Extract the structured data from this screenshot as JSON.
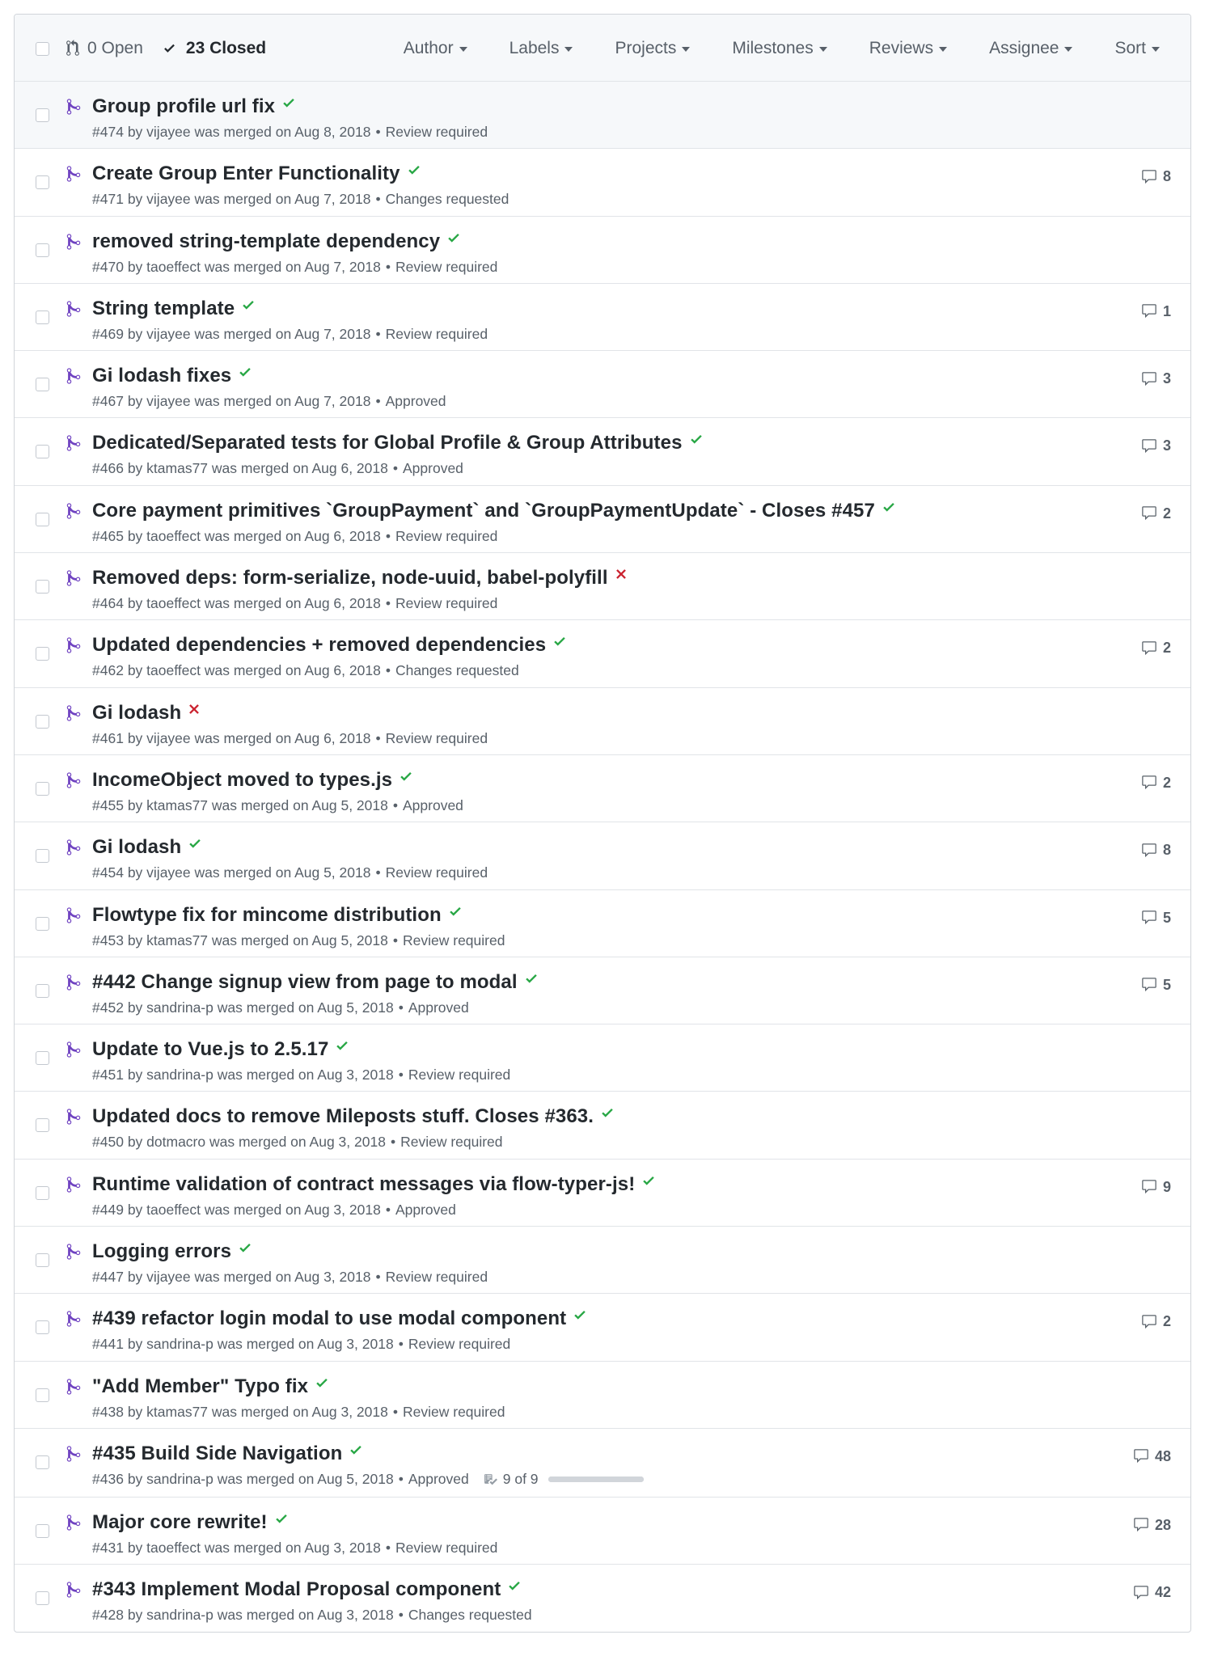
{
  "states": {
    "open": "0 Open",
    "closed": "23 Closed"
  },
  "filters": [
    "Author",
    "Labels",
    "Projects",
    "Milestones",
    "Reviews",
    "Assignee",
    "Sort"
  ],
  "colors": {
    "merged": "#6f42c1",
    "success": "#28a745",
    "failure": "#cb2431",
    "muted": "#586069"
  },
  "pull_requests": [
    {
      "title": "Group profile url fix",
      "status": "success",
      "meta": {
        "number": "#474",
        "by": "by",
        "author": "vijayee",
        "merged": "was merged on Aug 8, 2018",
        "review": "Review required"
      },
      "comments": ""
    },
    {
      "title": "Create Group Enter Functionality",
      "status": "success",
      "meta": {
        "number": "#471",
        "by": "by",
        "author": "vijayee",
        "merged": "was merged on Aug 7, 2018",
        "review": "Changes requested"
      },
      "comments": "8"
    },
    {
      "title": "removed string-template dependency",
      "status": "success",
      "meta": {
        "number": "#470",
        "by": "by",
        "author": "taoeffect",
        "merged": "was merged on Aug 7, 2018",
        "review": "Review required"
      },
      "comments": ""
    },
    {
      "title": "String template",
      "status": "success",
      "meta": {
        "number": "#469",
        "by": "by",
        "author": "vijayee",
        "merged": "was merged on Aug 7, 2018",
        "review": "Review required"
      },
      "comments": "1"
    },
    {
      "title": "Gi lodash fixes",
      "status": "success",
      "meta": {
        "number": "#467",
        "by": "by",
        "author": "vijayee",
        "merged": "was merged on Aug 7, 2018",
        "review": "Approved"
      },
      "comments": "3"
    },
    {
      "title": "Dedicated/Separated tests for Global Profile & Group Attributes",
      "status": "success",
      "meta": {
        "number": "#466",
        "by": "by",
        "author": "ktamas77",
        "merged": "was merged on Aug 6, 2018",
        "review": "Approved"
      },
      "comments": "3"
    },
    {
      "title": "Core payment primitives `GroupPayment` and `GroupPaymentUpdate` - Closes #457",
      "status": "success",
      "meta": {
        "number": "#465",
        "by": "by",
        "author": "taoeffect",
        "merged": "was merged on Aug 6, 2018",
        "review": "Review required"
      },
      "comments": "2"
    },
    {
      "title": "Removed deps: form-serialize, node-uuid, babel-polyfill",
      "status": "failure",
      "meta": {
        "number": "#464",
        "by": "by",
        "author": "taoeffect",
        "merged": "was merged on Aug 6, 2018",
        "review": "Review required"
      },
      "comments": ""
    },
    {
      "title": "Updated dependencies + removed dependencies",
      "status": "success",
      "meta": {
        "number": "#462",
        "by": "by",
        "author": "taoeffect",
        "merged": "was merged on Aug 6, 2018",
        "review": "Changes requested"
      },
      "comments": "2"
    },
    {
      "title": "Gi lodash",
      "status": "failure",
      "meta": {
        "number": "#461",
        "by": "by",
        "author": "vijayee",
        "merged": "was merged on Aug 6, 2018",
        "review": "Review required"
      },
      "comments": ""
    },
    {
      "title": "IncomeObject moved to types.js",
      "status": "success",
      "meta": {
        "number": "#455",
        "by": "by",
        "author": "ktamas77",
        "merged": "was merged on Aug 5, 2018",
        "review": "Approved"
      },
      "comments": "2"
    },
    {
      "title": "Gi lodash",
      "status": "success",
      "meta": {
        "number": "#454",
        "by": "by",
        "author": "vijayee",
        "merged": "was merged on Aug 5, 2018",
        "review": "Review required"
      },
      "comments": "8"
    },
    {
      "title": "Flowtype fix for mincome distribution",
      "status": "success",
      "meta": {
        "number": "#453",
        "by": "by",
        "author": "ktamas77",
        "merged": "was merged on Aug 5, 2018",
        "review": "Review required"
      },
      "comments": "5"
    },
    {
      "title": "#442 Change signup view from page to modal",
      "status": "success",
      "meta": {
        "number": "#452",
        "by": "by",
        "author": "sandrina-p",
        "merged": "was merged on Aug 5, 2018",
        "review": "Approved"
      },
      "comments": "5"
    },
    {
      "title": "Update to Vue.js to 2.5.17",
      "status": "success",
      "meta": {
        "number": "#451",
        "by": "by",
        "author": "sandrina-p",
        "merged": "was merged on Aug 3, 2018",
        "review": "Review required"
      },
      "comments": ""
    },
    {
      "title": "Updated docs to remove Mileposts stuff. Closes #363.",
      "status": "success",
      "meta": {
        "number": "#450",
        "by": "by",
        "author": "dotmacro",
        "merged": "was merged on Aug 3, 2018",
        "review": "Review required"
      },
      "comments": ""
    },
    {
      "title": "Runtime validation of contract messages via flow-typer-js!",
      "status": "success",
      "meta": {
        "number": "#449",
        "by": "by",
        "author": "taoeffect",
        "merged": "was merged on Aug 3, 2018",
        "review": "Approved"
      },
      "comments": "9"
    },
    {
      "title": "Logging errors",
      "status": "success",
      "meta": {
        "number": "#447",
        "by": "by",
        "author": "vijayee",
        "merged": "was merged on Aug 3, 2018",
        "review": "Review required"
      },
      "comments": ""
    },
    {
      "title": "#439 refactor login modal to use modal component",
      "status": "success",
      "meta": {
        "number": "#441",
        "by": "by",
        "author": "sandrina-p",
        "merged": "was merged on Aug 3, 2018",
        "review": "Review required"
      },
      "comments": "2"
    },
    {
      "title": "\"Add Member\" Typo fix",
      "status": "success",
      "meta": {
        "number": "#438",
        "by": "by",
        "author": "ktamas77",
        "merged": "was merged on Aug 3, 2018",
        "review": "Review required"
      },
      "comments": ""
    },
    {
      "title": "#435 Build Side Navigation",
      "status": "success",
      "meta": {
        "number": "#436",
        "by": "by",
        "author": "sandrina-p",
        "merged": "was merged on Aug 5, 2018",
        "review": "Approved"
      },
      "comments": "48",
      "tasks": {
        "label": "9 of 9",
        "progress": 1.0
      }
    },
    {
      "title": "Major core rewrite!",
      "status": "success",
      "meta": {
        "number": "#431",
        "by": "by",
        "author": "taoeffect",
        "merged": "was merged on Aug 3, 2018",
        "review": "Review required"
      },
      "comments": "28"
    },
    {
      "title": "#343 Implement Modal Proposal component",
      "status": "success",
      "meta": {
        "number": "#428",
        "by": "by",
        "author": "sandrina-p",
        "merged": "was merged on Aug 3, 2018",
        "review": "Changes requested"
      },
      "comments": "42"
    }
  ]
}
